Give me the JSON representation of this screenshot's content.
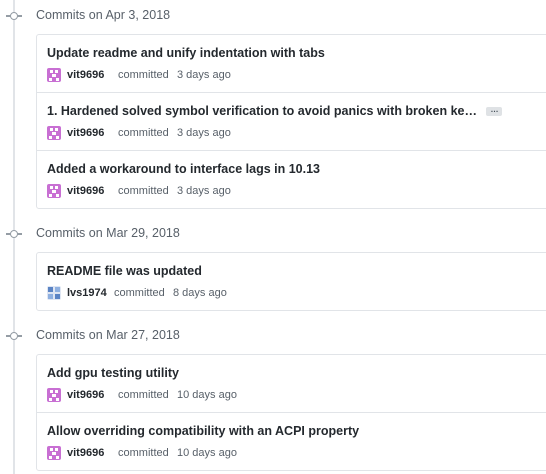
{
  "groups": [
    {
      "title": "Commits on Apr 3, 2018",
      "commits": [
        {
          "title": "Update readme and unify indentation with tabs",
          "author": "vit9696",
          "action": "committed",
          "when": "3 days ago",
          "avatar": "vit9696-avatar",
          "truncated": false
        },
        {
          "title": "1. Hardened solved symbol verification to avoid panics with broken ke…",
          "author": "vit9696",
          "action": "committed",
          "when": "3 days ago",
          "avatar": "vit9696-avatar",
          "truncated": true
        },
        {
          "title": "Added a workaround to interface lags in 10.13",
          "author": "vit9696",
          "action": "committed",
          "when": "3 days ago",
          "avatar": "vit9696-avatar",
          "truncated": false
        }
      ]
    },
    {
      "title": "Commits on Mar 29, 2018",
      "commits": [
        {
          "title": "README file was updated",
          "author": "lvs1974",
          "action": "committed",
          "when": "8 days ago",
          "avatar": "lvs1974-avatar",
          "truncated": false
        }
      ]
    },
    {
      "title": "Commits on Mar 27, 2018",
      "commits": [
        {
          "title": "Add gpu testing utility",
          "author": "vit9696",
          "action": "committed",
          "when": "10 days ago",
          "avatar": "vit9696-avatar",
          "truncated": false
        },
        {
          "title": "Allow overriding compatibility with an ACPI property",
          "author": "vit9696",
          "action": "committed",
          "when": "10 days ago",
          "avatar": "vit9696-avatar",
          "truncated": false
        }
      ]
    }
  ],
  "ellipsis_label": "…",
  "colors": {
    "vit9696_avatar": "#c86fd3",
    "lvs1974_avatar": "#5b84c4",
    "timeline": "#e1e4e8",
    "border": "#e1e4e8",
    "muted": "#586069"
  }
}
